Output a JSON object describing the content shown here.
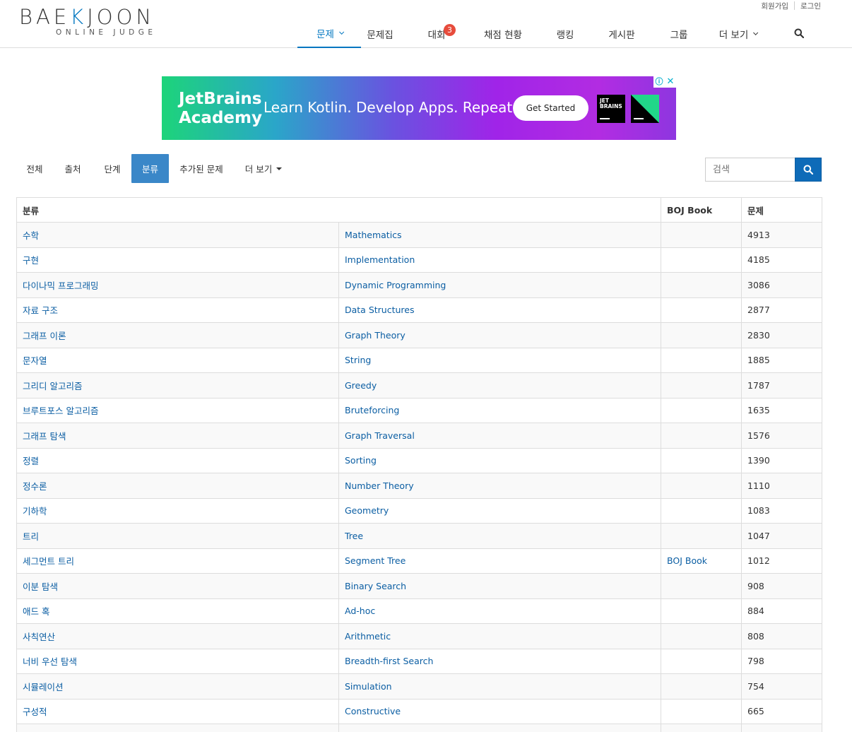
{
  "header": {
    "logo_main_pre": "BAE",
    "logo_main_k": "K",
    "logo_main_post": "JOON",
    "logo_sub": "ONLINE JUDGE",
    "top_links": [
      "회원가입",
      "로그인"
    ],
    "nav": [
      {
        "label": "문제",
        "active": true,
        "caret": true
      },
      {
        "label": "문제집"
      },
      {
        "label": "대회",
        "badge": "3"
      },
      {
        "label": "채점 현황"
      },
      {
        "label": "랭킹"
      },
      {
        "label": "게시판"
      },
      {
        "label": "그룹"
      },
      {
        "label": "더 보기",
        "caret": true
      }
    ]
  },
  "ad": {
    "brand_line1": "JetBrains",
    "brand_line2": "Academy",
    "tagline": "Learn Kotlin. Develop Apps. Repeat.",
    "button": "Get Started",
    "logo_text_1": "JET",
    "logo_text_2": "BRAINS",
    "info": "ⓘ",
    "close": "✕"
  },
  "subtabs": [
    {
      "label": "전체"
    },
    {
      "label": "출처"
    },
    {
      "label": "단계"
    },
    {
      "label": "분류",
      "active": true
    },
    {
      "label": "추가된 문제"
    },
    {
      "label": "더 보기",
      "caret": true
    }
  ],
  "search": {
    "placeholder": "검색"
  },
  "table": {
    "headers": [
      "분류",
      "BOJ Book",
      "문제"
    ],
    "rows": [
      {
        "ko": "수학",
        "en": "Mathematics",
        "book": "",
        "count": "4913"
      },
      {
        "ko": "구현",
        "en": "Implementation",
        "book": "",
        "count": "4185"
      },
      {
        "ko": "다이나믹 프로그래밍",
        "en": "Dynamic Programming",
        "book": "",
        "count": "3086"
      },
      {
        "ko": "자료 구조",
        "en": "Data Structures",
        "book": "",
        "count": "2877"
      },
      {
        "ko": "그래프 이론",
        "en": "Graph Theory",
        "book": "",
        "count": "2830"
      },
      {
        "ko": "문자열",
        "en": "String",
        "book": "",
        "count": "1885"
      },
      {
        "ko": "그리디 알고리즘",
        "en": "Greedy",
        "book": "",
        "count": "1787"
      },
      {
        "ko": "브루트포스 알고리즘",
        "en": "Bruteforcing",
        "book": "",
        "count": "1635"
      },
      {
        "ko": "그래프 탐색",
        "en": "Graph Traversal",
        "book": "",
        "count": "1576"
      },
      {
        "ko": "정렬",
        "en": "Sorting",
        "book": "",
        "count": "1390"
      },
      {
        "ko": "정수론",
        "en": "Number Theory",
        "book": "",
        "count": "1110"
      },
      {
        "ko": "기하학",
        "en": "Geometry",
        "book": "",
        "count": "1083"
      },
      {
        "ko": "트리",
        "en": "Tree",
        "book": "",
        "count": "1047"
      },
      {
        "ko": "세그먼트 트리",
        "en": "Segment Tree",
        "book": "BOJ Book",
        "count": "1012"
      },
      {
        "ko": "이분 탐색",
        "en": "Binary Search",
        "book": "",
        "count": "908"
      },
      {
        "ko": "애드 혹",
        "en": "Ad-hoc",
        "book": "",
        "count": "884"
      },
      {
        "ko": "사칙연산",
        "en": "Arithmetic",
        "book": "",
        "count": "808"
      },
      {
        "ko": "너비 우선 탐색",
        "en": "Breadth-first Search",
        "book": "",
        "count": "798"
      },
      {
        "ko": "시뮬레이션",
        "en": "Simulation",
        "book": "",
        "count": "754"
      },
      {
        "ko": "구성적",
        "en": "Constructive",
        "book": "",
        "count": "665"
      },
      {
        "ko": "",
        "en": "",
        "book": "",
        "count": ""
      }
    ]
  },
  "colors": {
    "accent": "#0076c0",
    "link": "#0b5ea3",
    "active_tab": "#3a87c8",
    "badge": "#e74c3c"
  }
}
